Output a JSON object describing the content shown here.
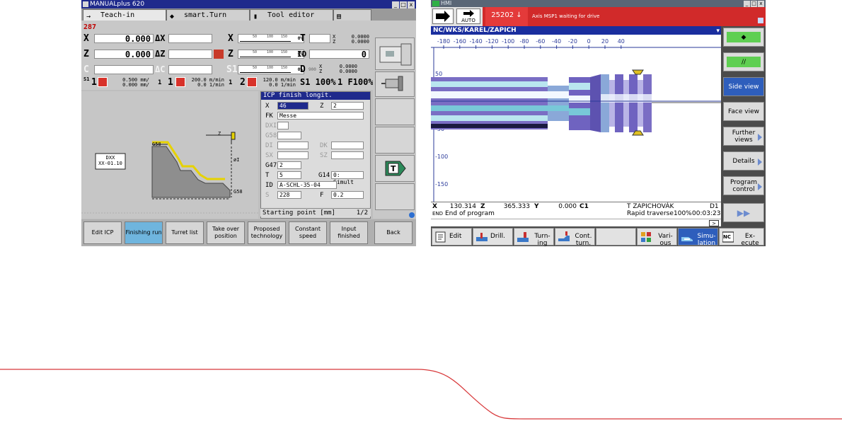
{
  "left": {
    "window_title": "MANUALplus 620",
    "win_buttons": [
      "_",
      "□",
      "x"
    ],
    "tabs": [
      {
        "label": "Teach-in",
        "icon": "→"
      },
      {
        "label": "smart.Turn",
        "icon": "◆"
      },
      {
        "label": "Tool editor",
        "icon": "▮"
      },
      {
        "label": "",
        "icon": "▤"
      }
    ],
    "block_number": "287",
    "rows": [
      {
        "axis": "X",
        "value": "0.000",
        "delta": "ΔX",
        "axis2": "X",
        "scale_pct": "0%",
        "tool": "T",
        "xz_x": "0.0000",
        "xz_z": "0.0000"
      },
      {
        "axis": "Z",
        "value": "0.000",
        "delta": "ΔZ",
        "axis2": "Z",
        "scale_pct": "0%",
        "tool": "ID",
        "id_value": "0"
      },
      {
        "axis": "C",
        "value": "",
        "delta": "ΔC",
        "axis2": "S1",
        "scale_pct": "0%",
        "tool": "D",
        "d_value": "900",
        "xz_x": "0.0000",
        "xz_z": "0.0000"
      }
    ],
    "scale_ticks": [
      "50",
      "100",
      "150"
    ],
    "feed_row": {
      "s1_label": "S1",
      "one": "1",
      "feed1": "0.500 mm/",
      "feed1b": "0.000 mm/",
      "gear": "1",
      "one2": "1",
      "rpm1": "200.0 m/min",
      "rpm1b": "0.0 1/min",
      "one3": "1",
      "two": "2",
      "rpm2": "120.0 m/min",
      "rpm2b": "0.0 1/min",
      "s_override": "S1 100%",
      "f_override": "1 F100%"
    },
    "canvas": {
      "g58_top": "G58",
      "g58_bottom": "G58",
      "label_line1": "DXX",
      "label_line2": "XX-01.10",
      "phi": "øI",
      "z_marker": "Z"
    },
    "panel": {
      "title": "ICP finish longit.",
      "x_label": "X",
      "x_value": "46",
      "z_label": "Z",
      "z_value": "2",
      "fk_label": "FK",
      "fk_value": "Messe",
      "dxi_label": "DXI",
      "g58_label": "G58",
      "di_label": "DI",
      "dk_label": "DK",
      "sx_label": "SX",
      "sz_label": "SZ",
      "g47_label": "G47",
      "g47_value": "2",
      "t_label": "T",
      "t_value": "5",
      "g14_label": "G14",
      "g14_value": "0: Simult",
      "id_label": "ID",
      "id_value": "A-SCHL-35-04",
      "s_label": "S",
      "s_value": "228",
      "f_label": "F",
      "f_value": "0.2"
    },
    "status": {
      "text": "Starting point [mm]",
      "page": "1/2"
    },
    "softkeys": [
      "Edit ICP",
      "Finishing run",
      "Turret list",
      "Take over position",
      "Proposed technology",
      "Constant speed",
      "Input finished",
      "Back"
    ],
    "active_softkey": "Finishing run"
  },
  "right": {
    "window_title": "HMI",
    "win_buttons": [
      "_",
      "□",
      "x"
    ],
    "mode_label": "AUTO",
    "alarm_number": "25202",
    "alarm_arrow": "↓",
    "alarm_message": "Axis MSP1 waiting for drive",
    "path": "NC/WKS/KAREL/ZAPICH",
    "x_ticks": [
      "-180",
      "-160",
      "-140",
      "-120",
      "-100",
      "-80",
      "-60",
      "-40",
      "-20",
      "0",
      "20",
      "40"
    ],
    "y_ticks": [
      "50",
      "0",
      "-50",
      "-100",
      "-150"
    ],
    "vsoftkeys": [
      {
        "label": "",
        "icon": "◆",
        "style": "green"
      },
      {
        "label": "",
        "icon": "//",
        "style": "green"
      },
      {
        "label": "Side view",
        "style": "blue"
      },
      {
        "label": "Face view",
        "style": "normal"
      },
      {
        "label": "Further views",
        "style": "normal",
        "arrow": true
      },
      {
        "label": "Details",
        "style": "normal",
        "arrow": true
      },
      {
        "label": "Program control",
        "style": "normal",
        "arrow": true
      },
      {
        "label": "▶▶",
        "style": "normal"
      }
    ],
    "info": {
      "x_label": "X",
      "x_value": "130.314",
      "z_label": "Z",
      "z_value": "365.333",
      "y_label": "Y",
      "y_value": "0.000",
      "c_label": "C1",
      "tool": "T ZAPICHOVÁK",
      "d_value": "D1",
      "end_label": "END",
      "end_text": "End of program",
      "traverse": "Rapid traverse",
      "override": "100%",
      "time": "00:03:23"
    },
    "scroll_btn": ">",
    "hsoftkeys": [
      {
        "label": "Edit",
        "icon": "edit"
      },
      {
        "label": "Drill.",
        "icon": "drill"
      },
      {
        "label": "Turn- ing",
        "icon": "turn"
      },
      {
        "label": "Cont. turn.",
        "icon": "cont"
      },
      {
        "label": "",
        "icon": ""
      },
      {
        "label": "Vari- ous",
        "icon": "various"
      },
      {
        "label": "Simu- lation",
        "icon": "sim",
        "active": true
      },
      {
        "label": "Ex- ecute",
        "icon": "nc"
      }
    ]
  }
}
